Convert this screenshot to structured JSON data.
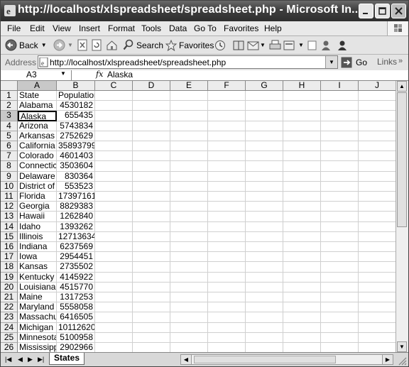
{
  "window": {
    "title": "http://localhost/xlspreadsheet/spreadsheet.php - Microsoft In..."
  },
  "menu": [
    "File",
    "Edit",
    "View",
    "Insert",
    "Format",
    "Tools",
    "Data",
    "Go To",
    "Favorites",
    "Help"
  ],
  "toolbar": {
    "back_label": "Back",
    "search_label": "Search",
    "favorites_label": "Favorites"
  },
  "address": {
    "label": "Address",
    "url": "http://localhost/xlspreadsheet/spreadsheet.php",
    "go_label": "Go",
    "links_label": "Links"
  },
  "formula": {
    "cell_ref": "A3",
    "fx": "fx",
    "value": "Alaska"
  },
  "columns": [
    "A",
    "B",
    "C",
    "D",
    "E",
    "F",
    "G",
    "H",
    "I",
    "J"
  ],
  "rows": [
    {
      "n": "1",
      "a": "State",
      "b": "Population"
    },
    {
      "n": "2",
      "a": "Alabama",
      "b": "4530182"
    },
    {
      "n": "3",
      "a": "Alaska",
      "b": "655435"
    },
    {
      "n": "4",
      "a": "Arizona",
      "b": "5743834"
    },
    {
      "n": "5",
      "a": "Arkansas",
      "b": "2752629"
    },
    {
      "n": "6",
      "a": "California",
      "b": "35893799"
    },
    {
      "n": "7",
      "a": "Colorado",
      "b": "4601403"
    },
    {
      "n": "8",
      "a": "Connecticut",
      "b": "3503604"
    },
    {
      "n": "9",
      "a": "Delaware",
      "b": "830364"
    },
    {
      "n": "10",
      "a": "District of Columbia",
      "b": "553523"
    },
    {
      "n": "11",
      "a": "Florida",
      "b": "17397161"
    },
    {
      "n": "12",
      "a": "Georgia",
      "b": "8829383"
    },
    {
      "n": "13",
      "a": "Hawaii",
      "b": "1262840"
    },
    {
      "n": "14",
      "a": "Idaho",
      "b": "1393262"
    },
    {
      "n": "15",
      "a": "Illinois",
      "b": "12713634"
    },
    {
      "n": "16",
      "a": "Indiana",
      "b": "6237569"
    },
    {
      "n": "17",
      "a": "Iowa",
      "b": "2954451"
    },
    {
      "n": "18",
      "a": "Kansas",
      "b": "2735502"
    },
    {
      "n": "19",
      "a": "Kentucky",
      "b": "4145922"
    },
    {
      "n": "20",
      "a": "Louisiana",
      "b": "4515770"
    },
    {
      "n": "21",
      "a": "Maine",
      "b": "1317253"
    },
    {
      "n": "22",
      "a": "Maryland",
      "b": "5558058"
    },
    {
      "n": "23",
      "a": "Massachusetts",
      "b": "6416505"
    },
    {
      "n": "24",
      "a": "Michigan",
      "b": "10112620"
    },
    {
      "n": "25",
      "a": "Minnesota",
      "b": "5100958"
    },
    {
      "n": "26",
      "a": "Mississippi",
      "b": "2902966"
    }
  ],
  "sheet_tab": "States",
  "selection": {
    "row": "3",
    "col": "A"
  }
}
